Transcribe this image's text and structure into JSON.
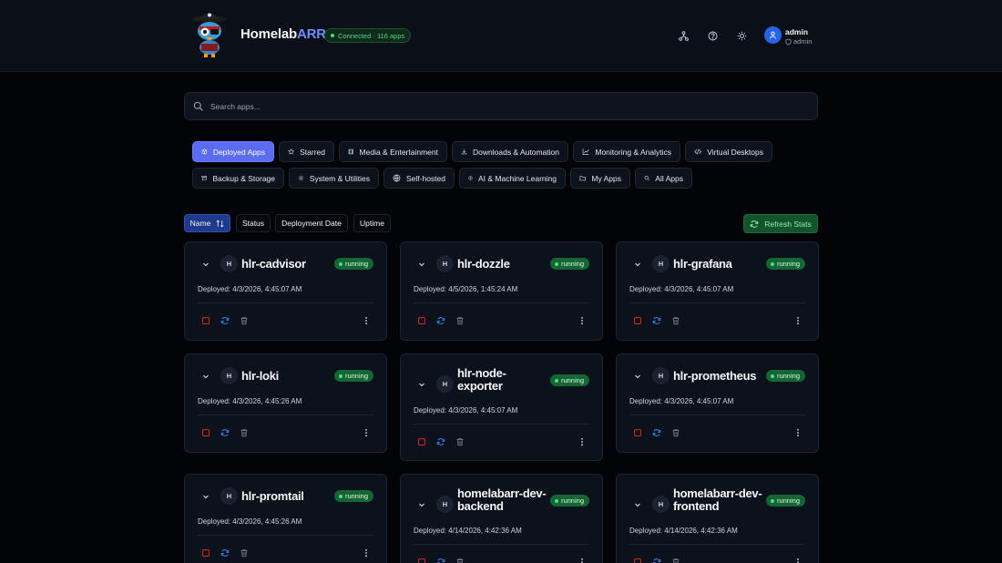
{
  "header": {
    "brand_main": "Homelab",
    "brand_accent": "ARR",
    "connection": "Connected · 116 apps",
    "icons": [
      "network-icon",
      "help-icon",
      "theme-toggle-icon"
    ],
    "user": {
      "name": "admin",
      "role": "admin"
    }
  },
  "search": {
    "placeholder": "Search apps...",
    "value": ""
  },
  "categories": [
    {
      "label": "Deployed Apps",
      "icon": "package-icon",
      "active": true
    },
    {
      "label": "Starred",
      "icon": "star-icon"
    },
    {
      "label": "Media & Entertainment",
      "icon": "film-icon"
    },
    {
      "label": "Downloads & Automation",
      "icon": "download-icon"
    },
    {
      "label": "Monitoring & Analytics",
      "icon": "chart-icon"
    },
    {
      "label": "Virtual Desktops",
      "icon": "code-icon"
    },
    {
      "label": "Backup & Storage",
      "icon": "archive-icon"
    },
    {
      "label": "System & Utilities",
      "icon": "gear-icon"
    },
    {
      "label": "Self-hosted",
      "icon": "globe-icon"
    },
    {
      "label": "AI & Machine Learning",
      "icon": "brain-icon"
    },
    {
      "label": "My Apps",
      "icon": "folder-icon"
    },
    {
      "label": "All Apps",
      "icon": "search-icon"
    }
  ],
  "sort": {
    "options": [
      "Name",
      "Status",
      "Deployment Date",
      "Uptime"
    ],
    "active": "Name",
    "refresh_label": "Refresh Stats"
  },
  "colors": {
    "accent": "#5b6cf0",
    "running": "#166534",
    "stop": "#dc2626",
    "restart": "#3b82f6"
  },
  "apps": [
    {
      "initial": "H",
      "name": "hlr-cadvisor",
      "status": "running",
      "deployed": "Deployed: 4/3/2026, 4:45:07 AM"
    },
    {
      "initial": "H",
      "name": "hlr-dozzle",
      "status": "running",
      "deployed": "Deployed: 4/5/2026, 1:45:24 AM"
    },
    {
      "initial": "H",
      "name": "hlr-grafana",
      "status": "running",
      "deployed": "Deployed: 4/3/2026, 4:45:07 AM"
    },
    {
      "initial": "H",
      "name": "hlr-loki",
      "status": "running",
      "deployed": "Deployed: 4/3/2026, 4:45:26 AM"
    },
    {
      "initial": "H",
      "name": "hlr-node-exporter",
      "status": "running",
      "deployed": "Deployed: 4/3/2026, 4:45:07 AM"
    },
    {
      "initial": "H",
      "name": "hlr-prometheus",
      "status": "running",
      "deployed": "Deployed: 4/3/2026, 4:45:07 AM"
    },
    {
      "initial": "H",
      "name": "hlr-promtail",
      "status": "running",
      "deployed": "Deployed: 4/3/2026, 4:45:26 AM"
    },
    {
      "initial": "H",
      "name": "homelabarr-dev-backend",
      "status": "running",
      "deployed": "Deployed: 4/14/2026, 4:42:36 AM"
    },
    {
      "initial": "H",
      "name": "homelabarr-dev-frontend",
      "status": "running",
      "deployed": "Deployed: 4/14/2026, 4:42:36 AM"
    }
  ]
}
